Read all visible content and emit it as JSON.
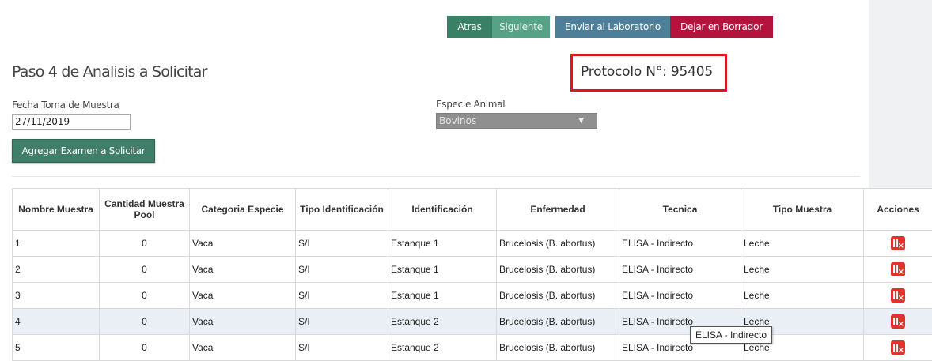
{
  "toolbar": {
    "atras": "Atras",
    "siguiente": "Siguiente",
    "enviar": "Enviar al Laboratorio",
    "borrador": "Dejar en Borrador"
  },
  "page": {
    "title": "Paso 4 de Analisis a Solicitar",
    "protocol": "Protocolo N°: 95405"
  },
  "form": {
    "fecha_label": "Fecha Toma de Muestra",
    "fecha_value": "27/11/2019",
    "especie_label": "Especie Animal",
    "especie_value": "Bovinos",
    "agregar_button": "Agregar Examen a Solicitar"
  },
  "table": {
    "headers": [
      "Nombre Muestra",
      "Cantidad Muestra Pool",
      "Categoria Especie",
      "Tipo Identificación",
      "Identificación",
      "Enfermedad",
      "Tecnica",
      "Tipo Muestra",
      "Acciones"
    ],
    "rows": [
      [
        "1",
        "0",
        "Vaca",
        "S/I",
        "Estanque 1",
        "Brucelosis (B. abortus)",
        "ELISA - Indirecto",
        "Leche"
      ],
      [
        "2",
        "0",
        "Vaca",
        "S/I",
        "Estanque 1",
        "Brucelosis (B. abortus)",
        "ELISA - Indirecto",
        "Leche"
      ],
      [
        "3",
        "0",
        "Vaca",
        "S/I",
        "Estanque 1",
        "Brucelosis (B. abortus)",
        "ELISA - Indirecto",
        "Leche"
      ],
      [
        "4",
        "0",
        "Vaca",
        "S/I",
        "Estanque 2",
        "Brucelosis (B. abortus)",
        "ELISA - Indirecto",
        "Leche"
      ],
      [
        "5",
        "0",
        "Vaca",
        "S/I",
        "Estanque 2",
        "Brucelosis (B. abortus)",
        "ELISA - Indirecto",
        "Leche"
      ]
    ],
    "highlighted_row": 4,
    "action_icon": "delete-icon"
  },
  "tooltip": "ELISA - Indirecto",
  "colors": {
    "atras": "#3a8066",
    "siguiente": "#56a287",
    "enviar": "#4e7f98",
    "borrador": "#b3133d",
    "protocol_border": "#e3141c",
    "delete_icon": "#e0332c"
  }
}
